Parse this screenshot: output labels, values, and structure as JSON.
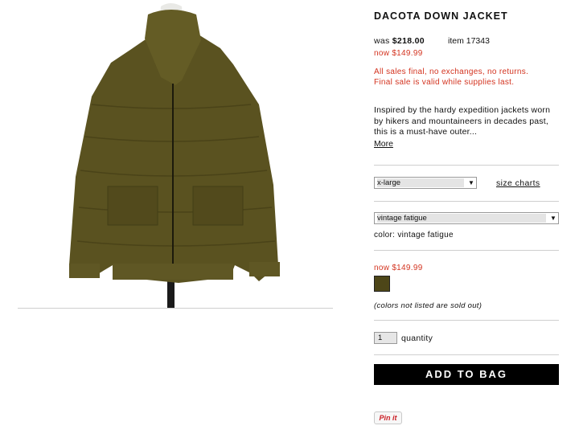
{
  "product": {
    "title": "DACOTA DOWN JACKET",
    "was_label": "was",
    "was_price": "$218.00",
    "item_label": "item 17343",
    "now_price": "now $149.99",
    "final_sale_line1": "All sales final, no exchanges, no returns.",
    "final_sale_line2": "Final sale is valid while supplies last.",
    "description": "Inspired by the hardy expedition jackets worn by hikers and mountaineers in decades past, this is a must-have outer...",
    "more_link": "More"
  },
  "size": {
    "selected": "x-large",
    "size_charts_link": "size charts"
  },
  "color": {
    "selected": "vintage fatigue",
    "label": "color: vintage fatigue",
    "swatch_color": "#4d4618"
  },
  "pricing": {
    "now_price": "now $149.99",
    "sold_out_note": "(colors not listed are sold out)"
  },
  "quantity": {
    "value": "1",
    "label": "quantity"
  },
  "actions": {
    "add_to_bag": "ADD TO BAG",
    "pin_it": "Pin it"
  }
}
